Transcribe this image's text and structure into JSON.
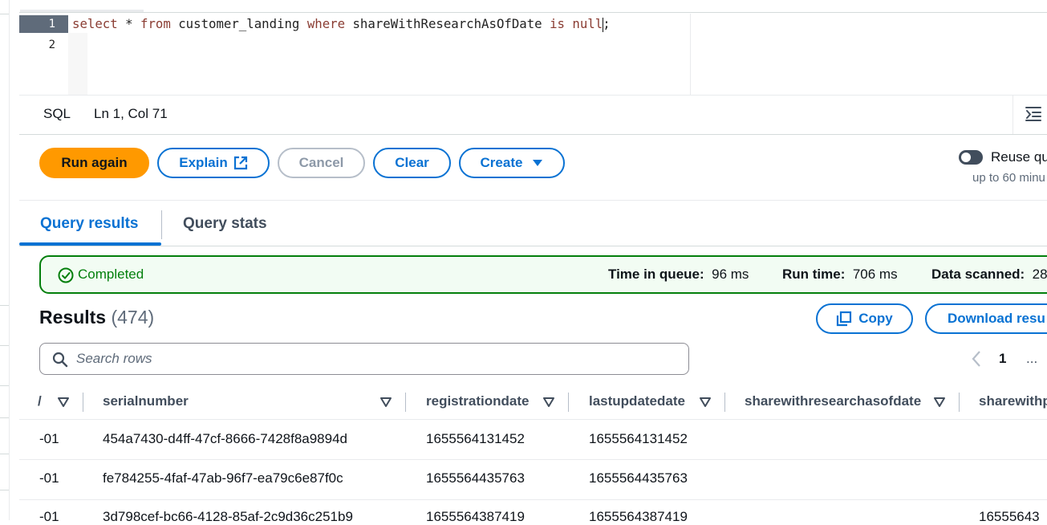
{
  "editor": {
    "line_numbers": [
      "1",
      "2"
    ],
    "code": {
      "t1": "select",
      "t2": " * ",
      "t3": "from",
      "t4": " customer_landing ",
      "t5": "where",
      "t6": " shareWithResearchAsOfDate ",
      "t7": "is",
      "t8": " ",
      "t9": "null",
      "t10": ";"
    }
  },
  "status_bar": {
    "language": "SQL",
    "cursor_position": "Ln 1, Col 71",
    "wrap_icon": "wrap-lines-icon"
  },
  "actions": {
    "run_label": "Run again",
    "explain_label": "Explain",
    "cancel_label": "Cancel",
    "clear_label": "Clear",
    "create_label": "Create",
    "reuse_label": "Reuse qu",
    "reuse_sublabel": "up to 60 minu"
  },
  "tabs": {
    "results_label": "Query results",
    "stats_label": "Query stats"
  },
  "status": {
    "state": "Completed",
    "queue_label": "Time in queue:",
    "queue_value": "96 ms",
    "runtime_label": "Run time:",
    "runtime_value": "706 ms",
    "scanned_label": "Data scanned:",
    "scanned_value": "28"
  },
  "results": {
    "title": "Results",
    "count": "(474)",
    "copy_label": "Copy",
    "download_label": "Download resu",
    "search_placeholder": "Search rows",
    "current_page": "1",
    "more_pages": "..."
  },
  "table": {
    "headers": {
      "partial": "/",
      "serialnumber": "serialnumber",
      "registrationdate": "registrationdate",
      "lastupdatedate": "lastupdatedate",
      "sharewithresearchasofdate": "sharewithresearchasofdate",
      "sharewithp": "sharewithp"
    },
    "rows": [
      {
        "c0": "-01",
        "serialnumber": "454a7430-d4ff-47cf-8666-7428f8a9894d",
        "registrationdate": "1655564131452",
        "lastupdatedate": "1655564131452",
        "sharewithresearchasofdate": "",
        "sharewithp": ""
      },
      {
        "c0": "-01",
        "serialnumber": "fe784255-4faf-47ab-96f7-ea79c6e87f0c",
        "registrationdate": "1655564435763",
        "lastupdatedate": "1655564435763",
        "sharewithresearchasofdate": "",
        "sharewithp": ""
      },
      {
        "c0": "-01",
        "serialnumber": "3d798cef-bc66-4128-85af-2c9d36c251b9",
        "registrationdate": "1655564387419",
        "lastupdatedate": "1655564387419",
        "sharewithresearchasofdate": "",
        "sharewithp": "16555643"
      }
    ]
  },
  "colors": {
    "primary": "#ff9900",
    "link": "#0972d3",
    "success": "#037f0c",
    "success_bg": "#f2fcf3"
  }
}
